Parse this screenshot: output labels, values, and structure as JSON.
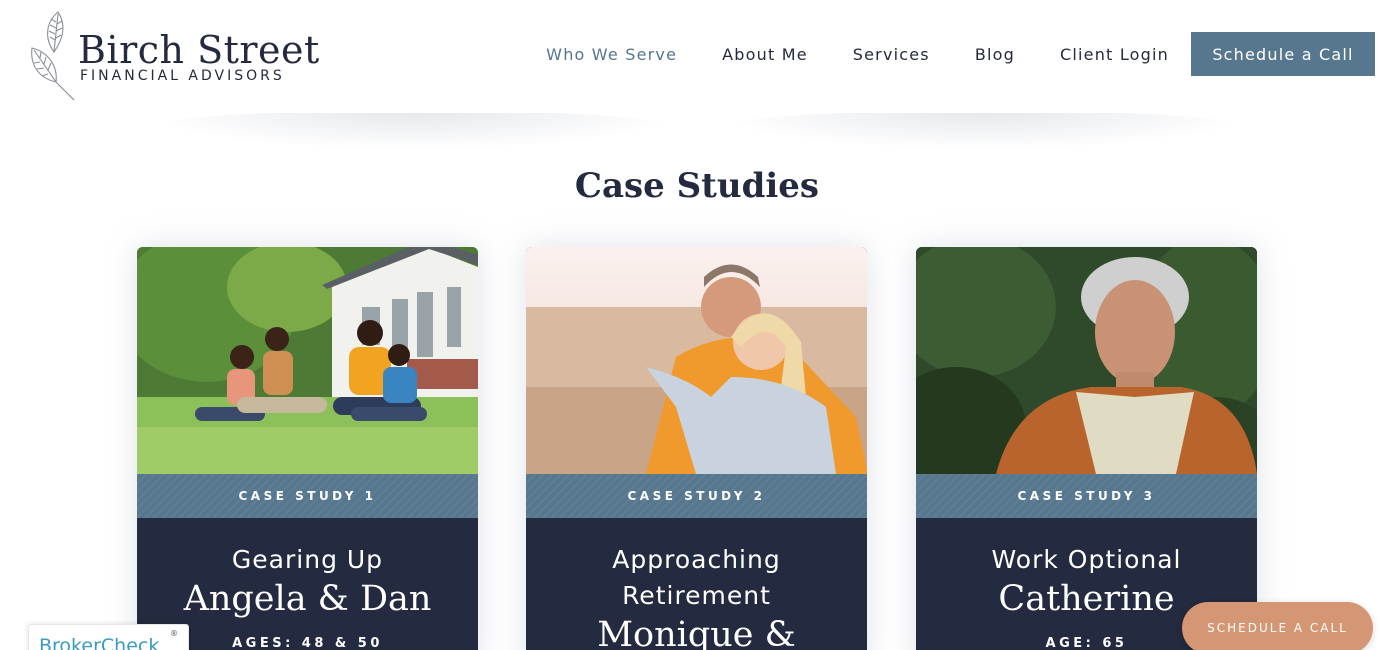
{
  "brand": {
    "name": "Birch Street",
    "tagline": "FINANCIAL ADVISORS"
  },
  "nav": {
    "items": [
      {
        "label": "Who We Serve",
        "active": true
      },
      {
        "label": "About Me"
      },
      {
        "label": "Services"
      },
      {
        "label": "Blog"
      },
      {
        "label": "Client Login"
      }
    ],
    "cta_label": "Schedule a Call"
  },
  "section": {
    "title": "Case Studies"
  },
  "cards": [
    {
      "band": "CASE STUDY 1",
      "subtitle": "Gearing Up",
      "name": "Angela & Dan",
      "ages": "AGES: 48 & 50",
      "image": "family-sitting-on-lawn-photo"
    },
    {
      "band": "CASE STUDY 2",
      "subtitle": "Approaching Retirement",
      "name": "Monique &",
      "image": "couple-on-beach-photo"
    },
    {
      "band": "CASE STUDY 3",
      "subtitle": "Work Optional",
      "name": "Catherine",
      "ages": "AGE: 65",
      "image": "woman-portrait-photo"
    }
  ],
  "broker_badge": {
    "label": "BrokerCheck",
    "reg": "®"
  },
  "floating_cta": {
    "label": "SCHEDULE A CALL"
  },
  "colors": {
    "navy": "#242a3f",
    "slate_blue": "#56778e",
    "peach": "#d49673"
  }
}
